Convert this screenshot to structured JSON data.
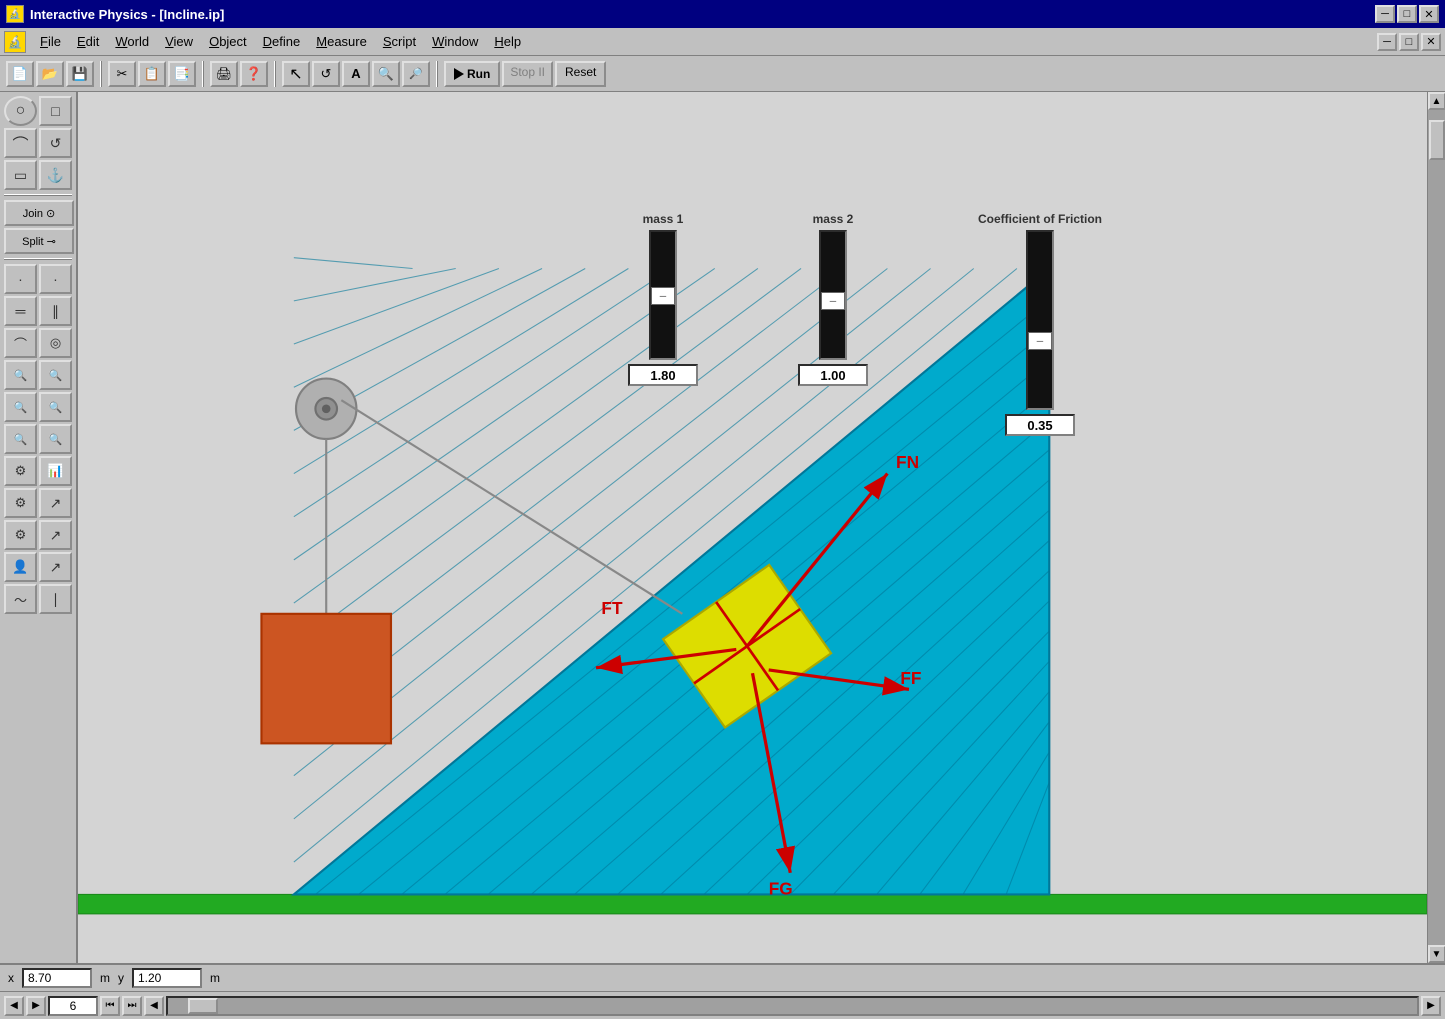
{
  "titleBar": {
    "icon": "🔬",
    "title": "Interactive Physics - [Incline.ip]",
    "minimize": "─",
    "maximize": "□",
    "close": "✕"
  },
  "menuBar": {
    "icon": "🔬",
    "items": [
      "File",
      "Edit",
      "World",
      "View",
      "Object",
      "Define",
      "Measure",
      "Script",
      "Window",
      "Help"
    ],
    "underlines": [
      0,
      0,
      0,
      0,
      0,
      0,
      0,
      0,
      0,
      0
    ],
    "windowButtons": [
      "─",
      "□",
      "✕"
    ]
  },
  "toolbar": {
    "tools": [
      "📄",
      "📂",
      "💾",
      "✂",
      "📋",
      "📑",
      "🖨",
      "❓",
      "↖",
      "↺",
      "A",
      "🔍",
      "🔍"
    ],
    "run": "Run",
    "stop": "Stop II",
    "reset": "Reset"
  },
  "toolbox": {
    "rows": [
      [
        "○",
        "□"
      ],
      [
        "⌒",
        "↺"
      ],
      [
        "▭",
        "⚓"
      ],
      [
        "join",
        "split"
      ],
      [
        "·",
        "·"
      ],
      [
        "═",
        "∥"
      ],
      [
        "⌒",
        "◎"
      ],
      [
        "🔍",
        "🔍"
      ],
      [
        "🔍",
        "🔍"
      ],
      [
        "🔍",
        "🔍"
      ],
      [
        "🔍",
        "🔍"
      ],
      [
        "⚙",
        "📊"
      ],
      [
        "⚙",
        "↗"
      ],
      [
        "⚙",
        "↗"
      ],
      [
        "👤",
        "↗"
      ],
      [
        "〜",
        "∣"
      ]
    ]
  },
  "sliders": {
    "mass1": {
      "label": "mass 1",
      "value": "1.80",
      "handlePos": 55
    },
    "mass2": {
      "label": "mass 2",
      "value": "1.00",
      "handlePos": 65
    },
    "friction": {
      "label": "Coefficient of Friction",
      "value": "0.35",
      "handlePos": 75
    }
  },
  "forceLabels": [
    "FN",
    "FT",
    "FF",
    "FG"
  ],
  "statusBar": {
    "xLabel": "x",
    "xValue": "8.70",
    "xUnit": "m",
    "yLabel": "y",
    "yValue": "1.20",
    "yUnit": "m"
  },
  "bottomControls": {
    "frameValue": "6",
    "prevFrame": "◀",
    "play": "▶",
    "stepBack": "⏮",
    "stepFwd": "⏭",
    "rewind": "◀"
  },
  "scrollbar": {
    "up": "▲",
    "down": "▼",
    "left": "◀",
    "right": "▶"
  }
}
